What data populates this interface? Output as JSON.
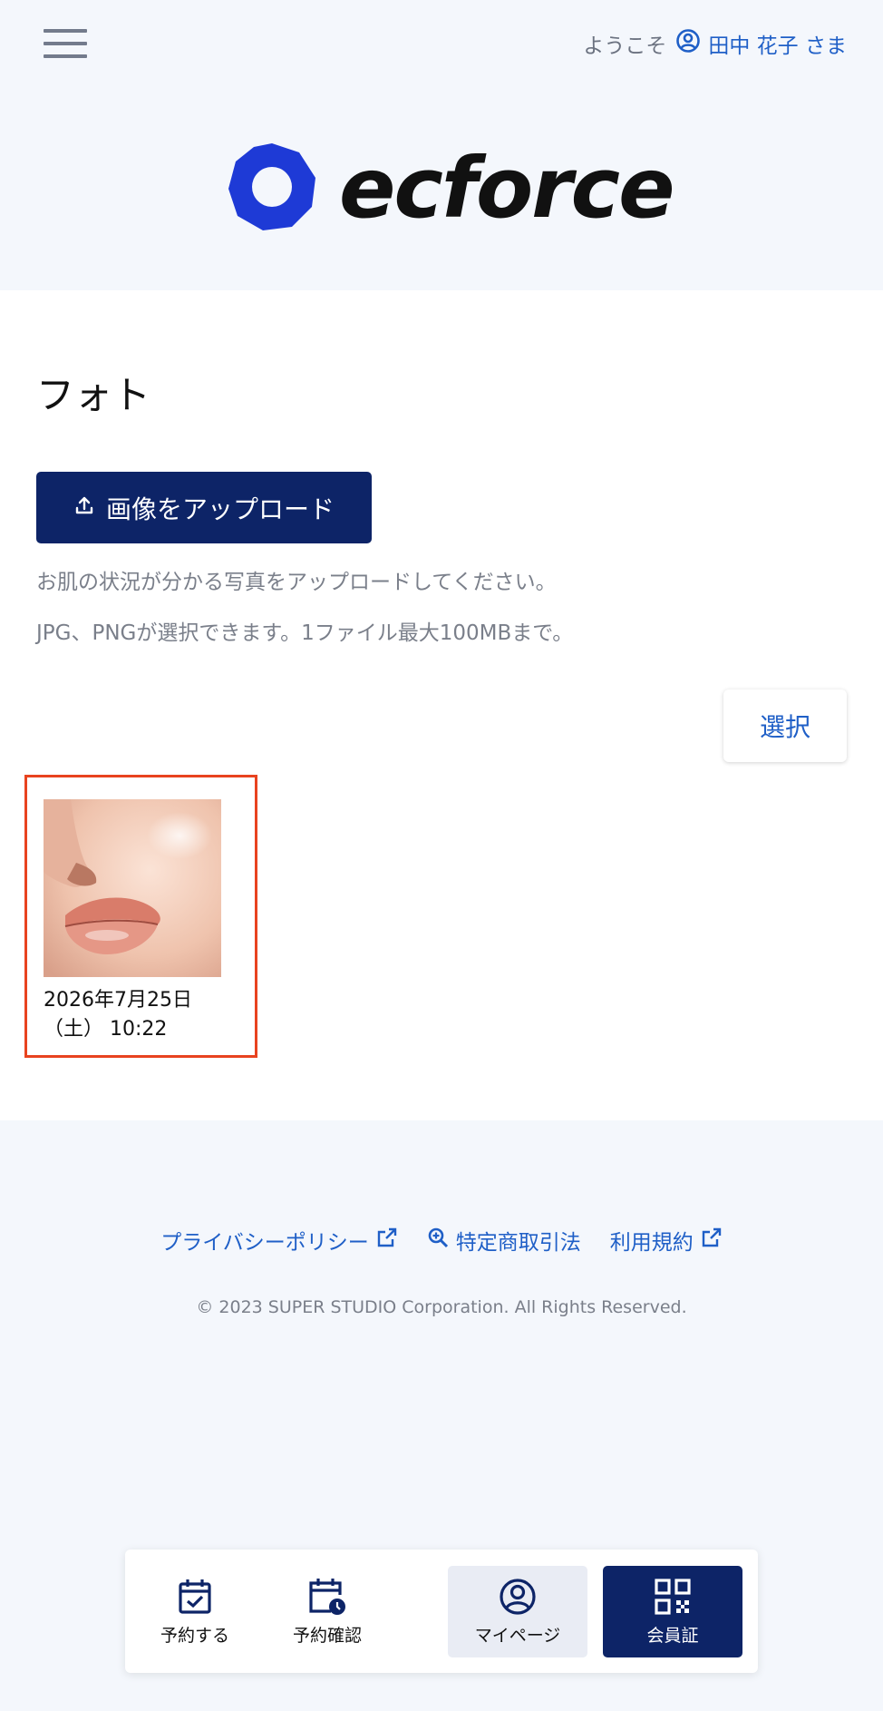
{
  "header": {
    "greeting": "ようこそ",
    "user_name": "田中 花子 さま",
    "logo_text": "ecforce"
  },
  "main": {
    "title": "フォト",
    "upload_label": "画像をアップロード",
    "note1": "お肌の状況が分かる写真をアップロードしてください。",
    "note2": "JPG、PNGが選択できます。1ファイル最大100MBまで。",
    "select_label": "選択",
    "photos": [
      {
        "date_line1": "2026年7月25日",
        "date_line2": "（土） 10:22"
      }
    ]
  },
  "footer": {
    "links": [
      {
        "label": "プライバシーポリシー",
        "icon": "external-link-icon"
      },
      {
        "label": "特定商取引法",
        "icon": "zoom-in-icon"
      },
      {
        "label": "利用規約",
        "icon": "external-link-icon"
      }
    ],
    "copyright": "© 2023 SUPER STUDIO Corporation. All Rights Reserved."
  },
  "bottom_nav": {
    "items": [
      {
        "label": "予約する",
        "icon": "calendar-check-icon"
      },
      {
        "label": "予約確認",
        "icon": "calendar-clock-icon"
      },
      {
        "label": "マイページ",
        "icon": "user-circle-icon"
      },
      {
        "label": "会員証",
        "icon": "qr-code-icon"
      }
    ]
  },
  "colors": {
    "primary_navy": "#0d2467",
    "link_blue": "#1f5fc7",
    "logo_blue": "#1e3ad6",
    "highlight_red": "#e8431f",
    "page_bg": "#f4f7fc"
  }
}
